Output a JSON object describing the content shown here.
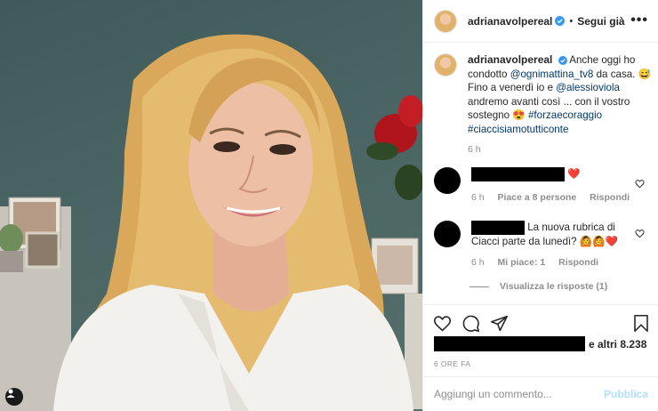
{
  "post": {
    "username": "adrianavolpereal",
    "follow_label": "Segui già",
    "more_icon": "more-horizontal-icon",
    "verified_icon": "verified-badge-icon"
  },
  "caption": {
    "username": "adrianavolpereal",
    "text_1": "Anche oggi ho condotto",
    "mention_1": "@ognimattina_tv8",
    "text_2": "da casa.",
    "emoji_1": "😅",
    "text_3": "Fino a venerdì io e",
    "mention_2": "@alessioviola",
    "text_4": "andremo avanti così ... con il vostro sostegno",
    "emoji_2": "😍",
    "hashtag_1": "#forzaecoraggio",
    "hashtag_2": "#ciaccisiamotutticonte",
    "time": "6 h"
  },
  "comments": [
    {
      "text": "❤️",
      "time": "6 h",
      "likes": "Piace a 8 persone",
      "reply": "Rispondi"
    },
    {
      "text": "La nuova rubrica di Ciacci parte da lunedì?",
      "emojis": "🙆🙆❤️",
      "time": "6 h",
      "likes": "Mi piace: 1",
      "reply": "Rispondi"
    }
  ],
  "view_replies": "Visualizza le risposte (1)",
  "likes_suffix": "e altri 8.238",
  "posted_ago": "6 ORE FA",
  "composer": {
    "placeholder": "Aggiungi un commento...",
    "publish_label": "Pubblica"
  },
  "colors": {
    "link": "#00376b",
    "verified": "#3897f0",
    "heart": "#ed4956",
    "publish_disabled": "#b2dffc"
  }
}
